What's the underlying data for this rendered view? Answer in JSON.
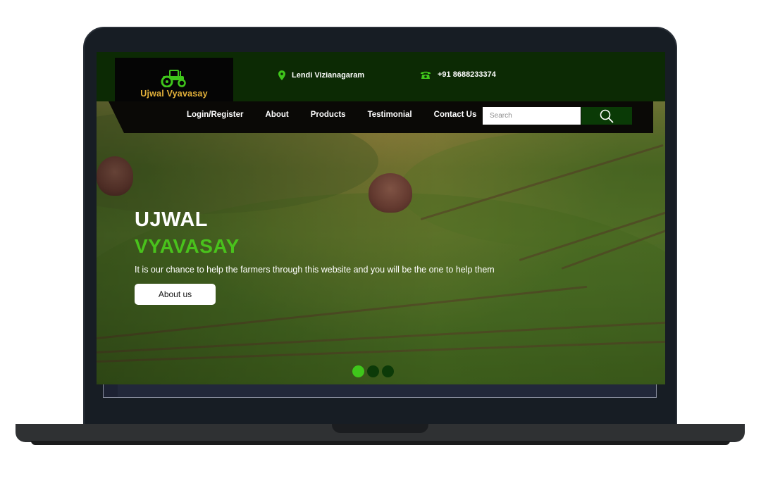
{
  "brand": {
    "name": "Ujwal Vyavasay",
    "color": "#e3b13a",
    "icon": "tractor-icon"
  },
  "contact": {
    "location": {
      "icon": "map-pin-icon",
      "text": "Lendi Vizianagaram"
    },
    "phone": {
      "icon": "phone-icon",
      "text": "+91 8688233374"
    }
  },
  "nav": {
    "items": [
      {
        "label": "Login/Register"
      },
      {
        "label": "About"
      },
      {
        "label": "Products"
      },
      {
        "label": "Testimonial"
      },
      {
        "label": "Contact Us"
      }
    ],
    "search": {
      "placeholder": "Search",
      "value": "",
      "icon": "search-icon"
    }
  },
  "hero": {
    "title_line1": "UJWAL",
    "title_line2": "VYAVASAY",
    "subtitle": "It is our chance to help the farmers through this website and you will be the one to help them",
    "cta_label": "About us",
    "slides": {
      "count": 3,
      "active": 1
    }
  },
  "colors": {
    "accent_green": "#49c21c",
    "topbar": "#0c2a04",
    "nav": "#0a0906"
  }
}
